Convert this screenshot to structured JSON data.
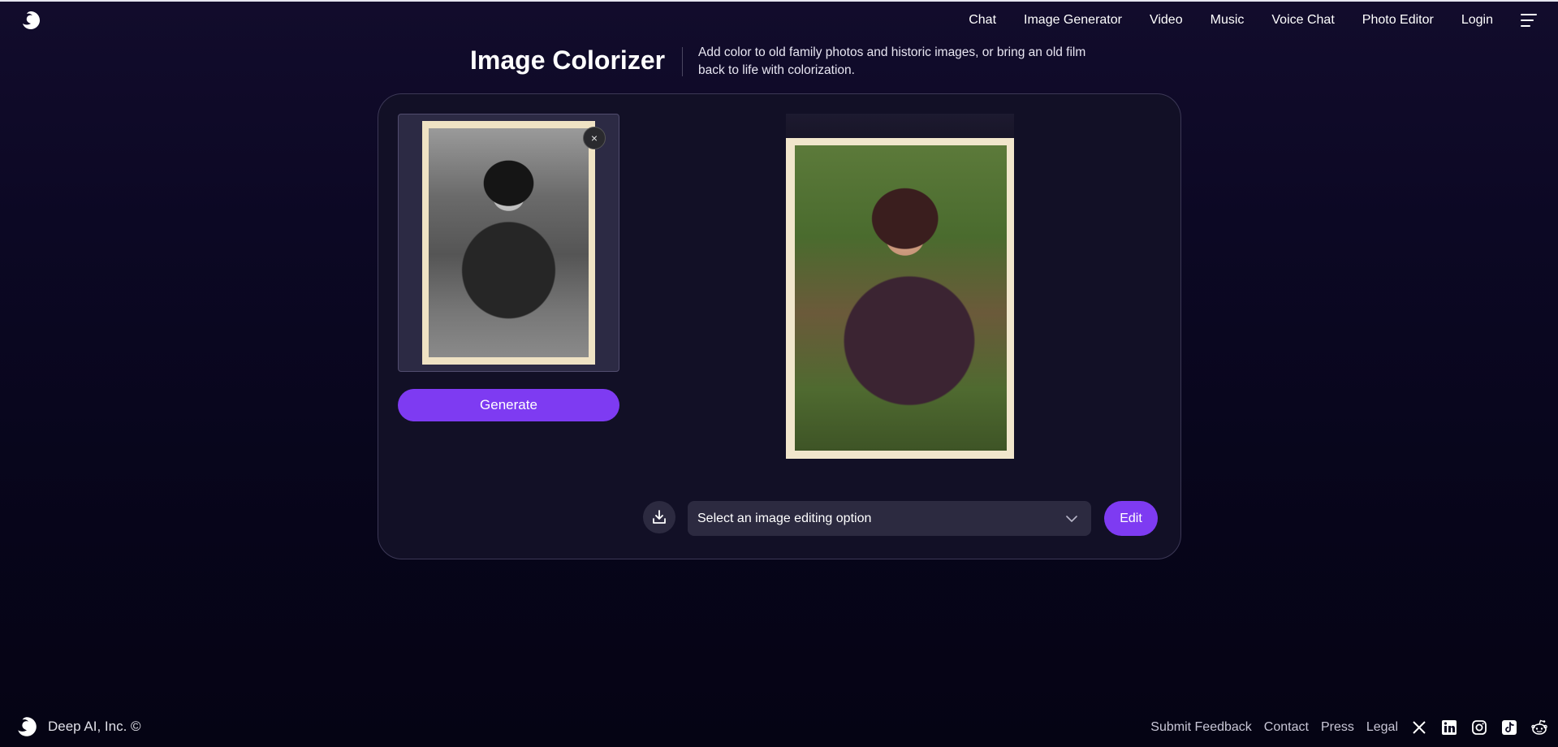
{
  "header": {
    "logo_icon": "deepai-logo-icon",
    "nav": [
      "Chat",
      "Image Generator",
      "Video",
      "Music",
      "Voice Chat",
      "Photo Editor",
      "Login"
    ],
    "menu_icon": "hamburger-menu-icon"
  },
  "page": {
    "title": "Image Colorizer",
    "subtitle": "Add color to old family photos and historic images, or bring an old film back to life with colorization."
  },
  "tool": {
    "close_label": "×",
    "generate_label": "Generate",
    "download_icon": "download-icon",
    "select_label": "Select an image editing option",
    "edit_label": "Edit"
  },
  "footer": {
    "copyright": "Deep AI, Inc. ©",
    "links": [
      "Submit Feedback",
      "Contact",
      "Press",
      "Legal"
    ],
    "social_icons": [
      "x-icon",
      "linkedin-icon",
      "instagram-icon",
      "tiktok-icon",
      "reddit-icon"
    ]
  },
  "colors": {
    "accent": "#7e3bf2",
    "background": "#0c0824",
    "panel": "#121026"
  }
}
